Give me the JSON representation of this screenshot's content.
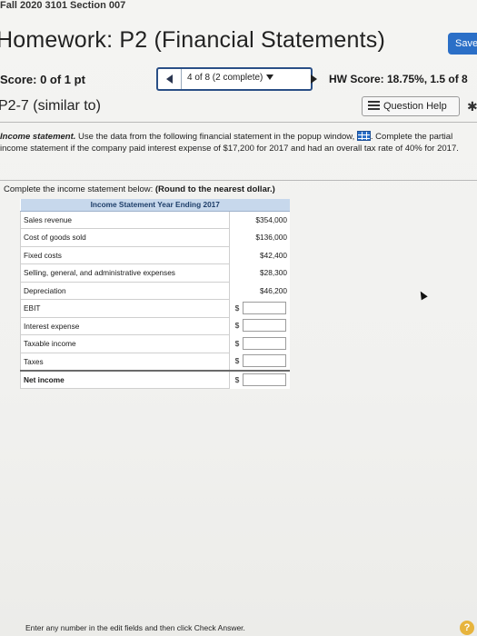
{
  "header": {
    "course": "Fall 2020 3101 Section 007",
    "title": "Homework: P2 (Financial Statements)",
    "save_label": "Save"
  },
  "score_row": {
    "score": "Score: 0 of 1 pt",
    "question_nav": "4 of 8 (2 complete)",
    "hw_score": "HW Score: 18.75%, 1.5 of 8"
  },
  "problem": {
    "id": "P2-7 (similar to)",
    "help_label": "Question Help"
  },
  "instructions": {
    "lead": "Income statement.",
    "text_1": " Use the data from the following financial statement in the popup window,",
    "text_2": ". Complete the partial income statement if the company paid interest expense of $17,200 for 2017 and had an overall tax rate of 40% for 2017."
  },
  "work": {
    "intro_prefix": "Complete the income statement below: ",
    "intro_bold": "(Round to the nearest dollar.)",
    "table_title": "Income Statement Year Ending 2017",
    "rows": [
      {
        "label": "Sales revenue",
        "value": "$354,000"
      },
      {
        "label": "Cost of goods sold",
        "value": "$136,000"
      },
      {
        "label": "Fixed costs",
        "value": "$42,400"
      },
      {
        "label": "Selling, general, and administrative expenses",
        "value": "$28,300"
      },
      {
        "label": "Depreciation",
        "value": "$46,200"
      }
    ],
    "input_rows": [
      {
        "label": "EBIT",
        "currency": "$"
      },
      {
        "label": "Interest expense",
        "currency": "$"
      },
      {
        "label": "Taxable income",
        "currency": "$"
      },
      {
        "label": "Taxes",
        "currency": "$"
      },
      {
        "label": "Net income",
        "currency": "$"
      }
    ],
    "footer": "Enter any number in the edit fields and then click Check Answer.",
    "help_circle": "?"
  }
}
